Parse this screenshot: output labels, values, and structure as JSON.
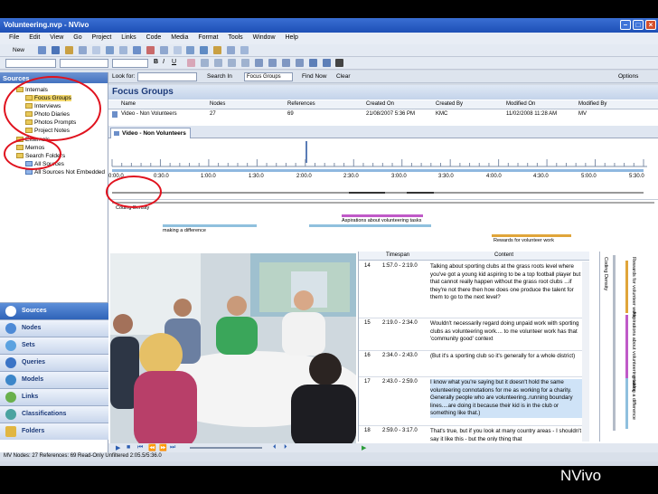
{
  "window": {
    "title": "Volunteering.nvp - NVivo"
  },
  "menu": [
    "File",
    "Edit",
    "View",
    "Go",
    "Project",
    "Links",
    "Code",
    "Media",
    "Format",
    "Tools",
    "Window",
    "Help"
  ],
  "toolbar": {
    "new_label": "New"
  },
  "lookbar": {
    "look_for_label": "Look for:",
    "search_in_label": "Search In",
    "search_in_value": "Focus Groups",
    "find_now": "Find Now",
    "clear": "Clear",
    "options": "Options"
  },
  "sources_pane": {
    "header": "Sources",
    "tree": {
      "internals": "Internals",
      "children": [
        "Focus Groups",
        "Interviews",
        "Photo Diaries",
        "Photos Prompts",
        "Project Notes"
      ],
      "externals": "Externals",
      "memos": "Memos",
      "search_folders": "Search Folders",
      "search_children": [
        "All Sources",
        "All Sources Not Embedded"
      ]
    }
  },
  "nav_buttons": [
    "Sources",
    "Nodes",
    "Sets",
    "Queries",
    "Models",
    "Links",
    "Classifications",
    "Folders"
  ],
  "list": {
    "title": "Focus Groups",
    "columns": [
      "Name",
      "Nodes",
      "References",
      "Created On",
      "Created By",
      "Modified On",
      "Modified By"
    ],
    "row": [
      "Video - Non Volunteers",
      "27",
      "69",
      "21/08/2007 5:36 PM",
      "KMC",
      "11/02/2008 11:28 AM",
      "MV"
    ]
  },
  "detail_tab": "Video - Non Volunteers",
  "timeline": {
    "ticks": [
      "0:00.0",
      "0:30.0",
      "1:00.0",
      "1:30.0",
      "2:00.0",
      "2:30.0",
      "3:00.0",
      "3:30.0",
      "4:00.0",
      "4:30.0",
      "5:00.0",
      "5:30.0"
    ]
  },
  "coding_density_label": "Coding Density",
  "coding_stripes": [
    {
      "label": "making a difference",
      "color": "#8fc0de"
    },
    {
      "label": "Aspirations about volunteering tasks",
      "color": "#c05ac8"
    },
    {
      "label": "Rewards for volunteer work",
      "color": "#e0a53a"
    }
  ],
  "transcript": {
    "columns": [
      "Timespan",
      "Content"
    ],
    "rows": [
      {
        "n": "14",
        "ts": "1:57.0 - 2:19.0",
        "text": "Talking about sporting clubs at the grass roots level where you've got a young kid aspiring to be a top football player but that cannot really happen without the grass root clubs ...if they're not there then how does one produce the talent for them to go to the next level?"
      },
      {
        "n": "15",
        "ts": "2:19.0 - 2:34.0",
        "text": "Wouldn't necessarily regard doing unpaid work with sporting clubs as volunteering work.... to me volunteer work has that 'community good' context"
      },
      {
        "n": "16",
        "ts": "2:34.0 - 2:43.0",
        "text": "(But it's a sporting club so it's generally for a whole district)"
      },
      {
        "n": "17",
        "ts": "2:43.0 - 2:59.0",
        "text": "I know what you're saying but it doesn't hold the same volunteering connotations for me as working for a charity. Generally people who are volunteering..running boundary lines....are doing it because their kid is in the club or something like that.)"
      },
      {
        "n": "18",
        "ts": "2:59.0 - 3:17.0",
        "text": "That's true, but if you look at many country areas - I shouldn't say it like this - but the only thing that"
      }
    ]
  },
  "side_stripes": [
    "Coding Density",
    "Rewards for volunteer work",
    "Aspirations about volunteering tasks",
    "making a difference"
  ],
  "status": {
    "text": "MV   Nodes: 27  References: 69     Read-Only     Unfiltered    2:05.5/5:36.0"
  },
  "caption": "NVivo"
}
